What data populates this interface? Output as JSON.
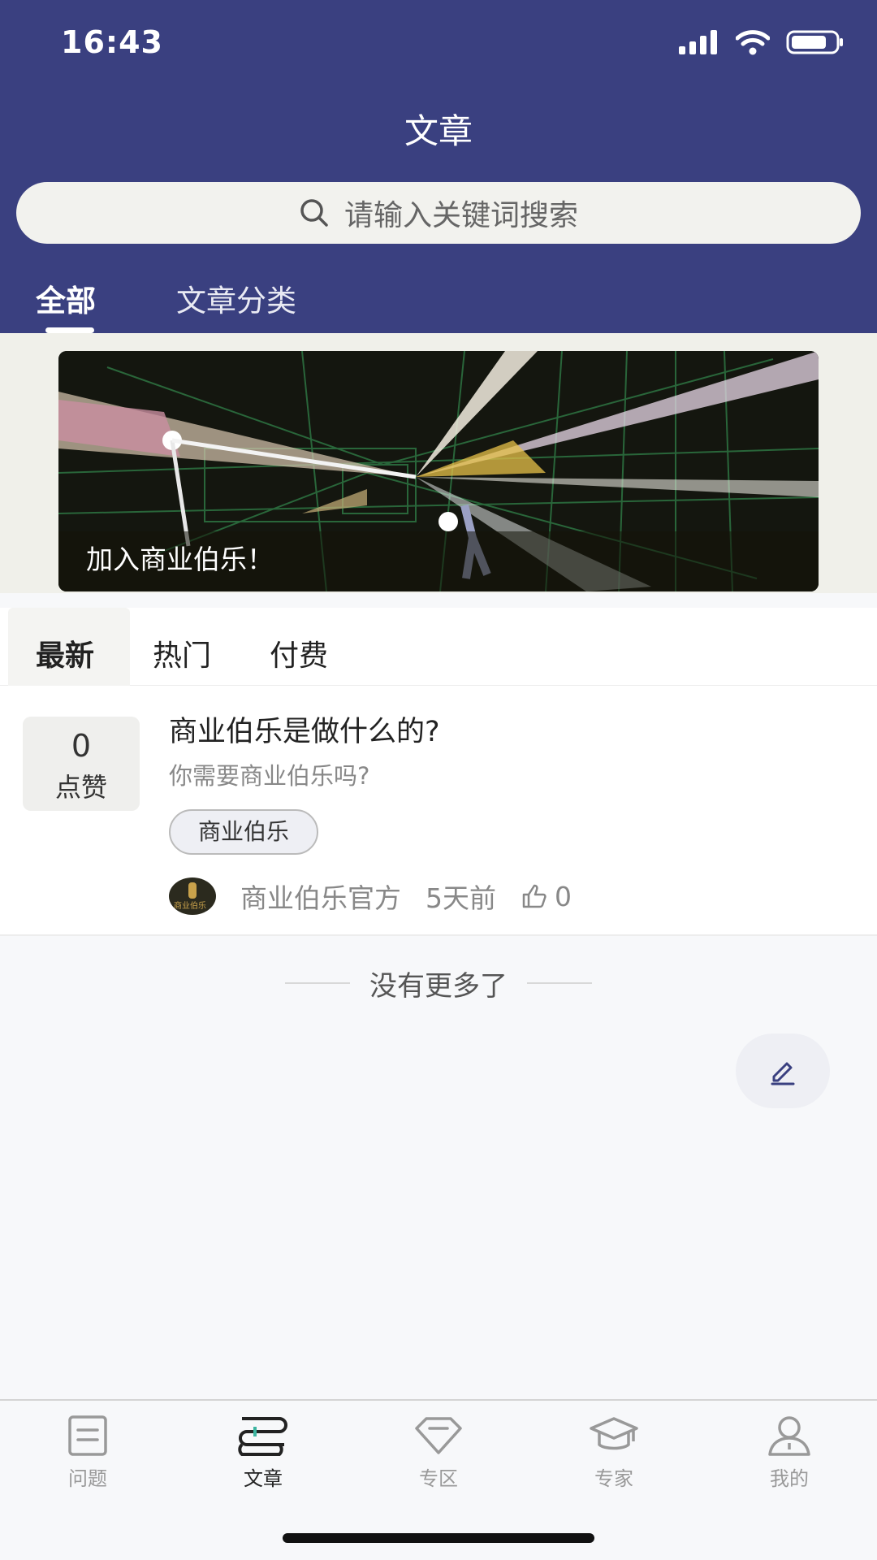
{
  "status_bar": {
    "time": "16:43"
  },
  "header": {
    "title": "文章"
  },
  "search": {
    "placeholder": "请输入关键词搜索"
  },
  "top_tabs": [
    {
      "label": "全部"
    },
    {
      "label": "文章分类"
    }
  ],
  "banner": {
    "caption": "加入商业伯乐！"
  },
  "sub_tabs": [
    {
      "label": "最新"
    },
    {
      "label": "热门"
    },
    {
      "label": "付费"
    }
  ],
  "articles": [
    {
      "like_count": "0",
      "like_label": "点赞",
      "title": "商业伯乐是做什么的?",
      "description": "你需要商业伯乐吗?",
      "tag": "商业伯乐",
      "author": "商业伯乐官方",
      "time": "5天前",
      "likes": "0"
    }
  ],
  "list_footer": "没有更多了",
  "tabbar": [
    {
      "label": "问题",
      "icon": "question-list-icon",
      "active": false
    },
    {
      "label": "文章",
      "icon": "article-icon",
      "active": true
    },
    {
      "label": "专区",
      "icon": "diamond-icon",
      "active": false
    },
    {
      "label": "专家",
      "icon": "graduation-cap-icon",
      "active": false
    },
    {
      "label": "我的",
      "icon": "user-icon",
      "active": false
    }
  ],
  "colors": {
    "header_bg": "#3a4080",
    "background": "#f7f8fa",
    "active_text": "#222222",
    "inactive_text": "#999999"
  }
}
